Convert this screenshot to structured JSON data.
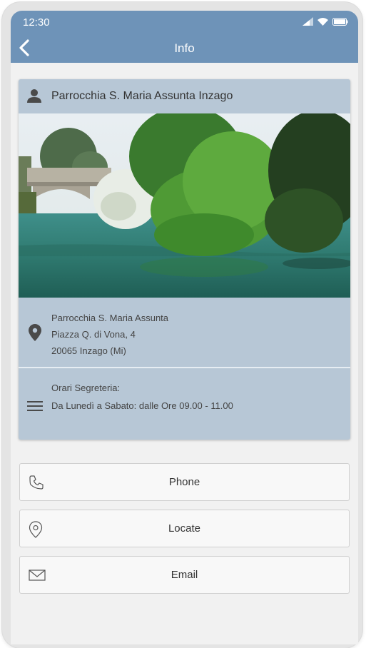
{
  "status": {
    "time": "12:30"
  },
  "header": {
    "title": "Info"
  },
  "card": {
    "name": "Parrocchia S. Maria Assunta Inzago",
    "address": {
      "line1": "Parrocchia S. Maria Assunta",
      "line2": "Piazza Q. di Vona, 4",
      "line3": "20065 Inzago (Mi)"
    },
    "hours": {
      "label": "Orari Segreteria:",
      "value": "Da Lunedì a Sabato: dalle Ore 09.00 - 11.00"
    }
  },
  "actions": {
    "phone": "Phone",
    "locate": "Locate",
    "email": "Email"
  },
  "colors": {
    "appbar": "#6e93b8",
    "card": "#b7c7d6",
    "background": "#f1f1f1"
  }
}
